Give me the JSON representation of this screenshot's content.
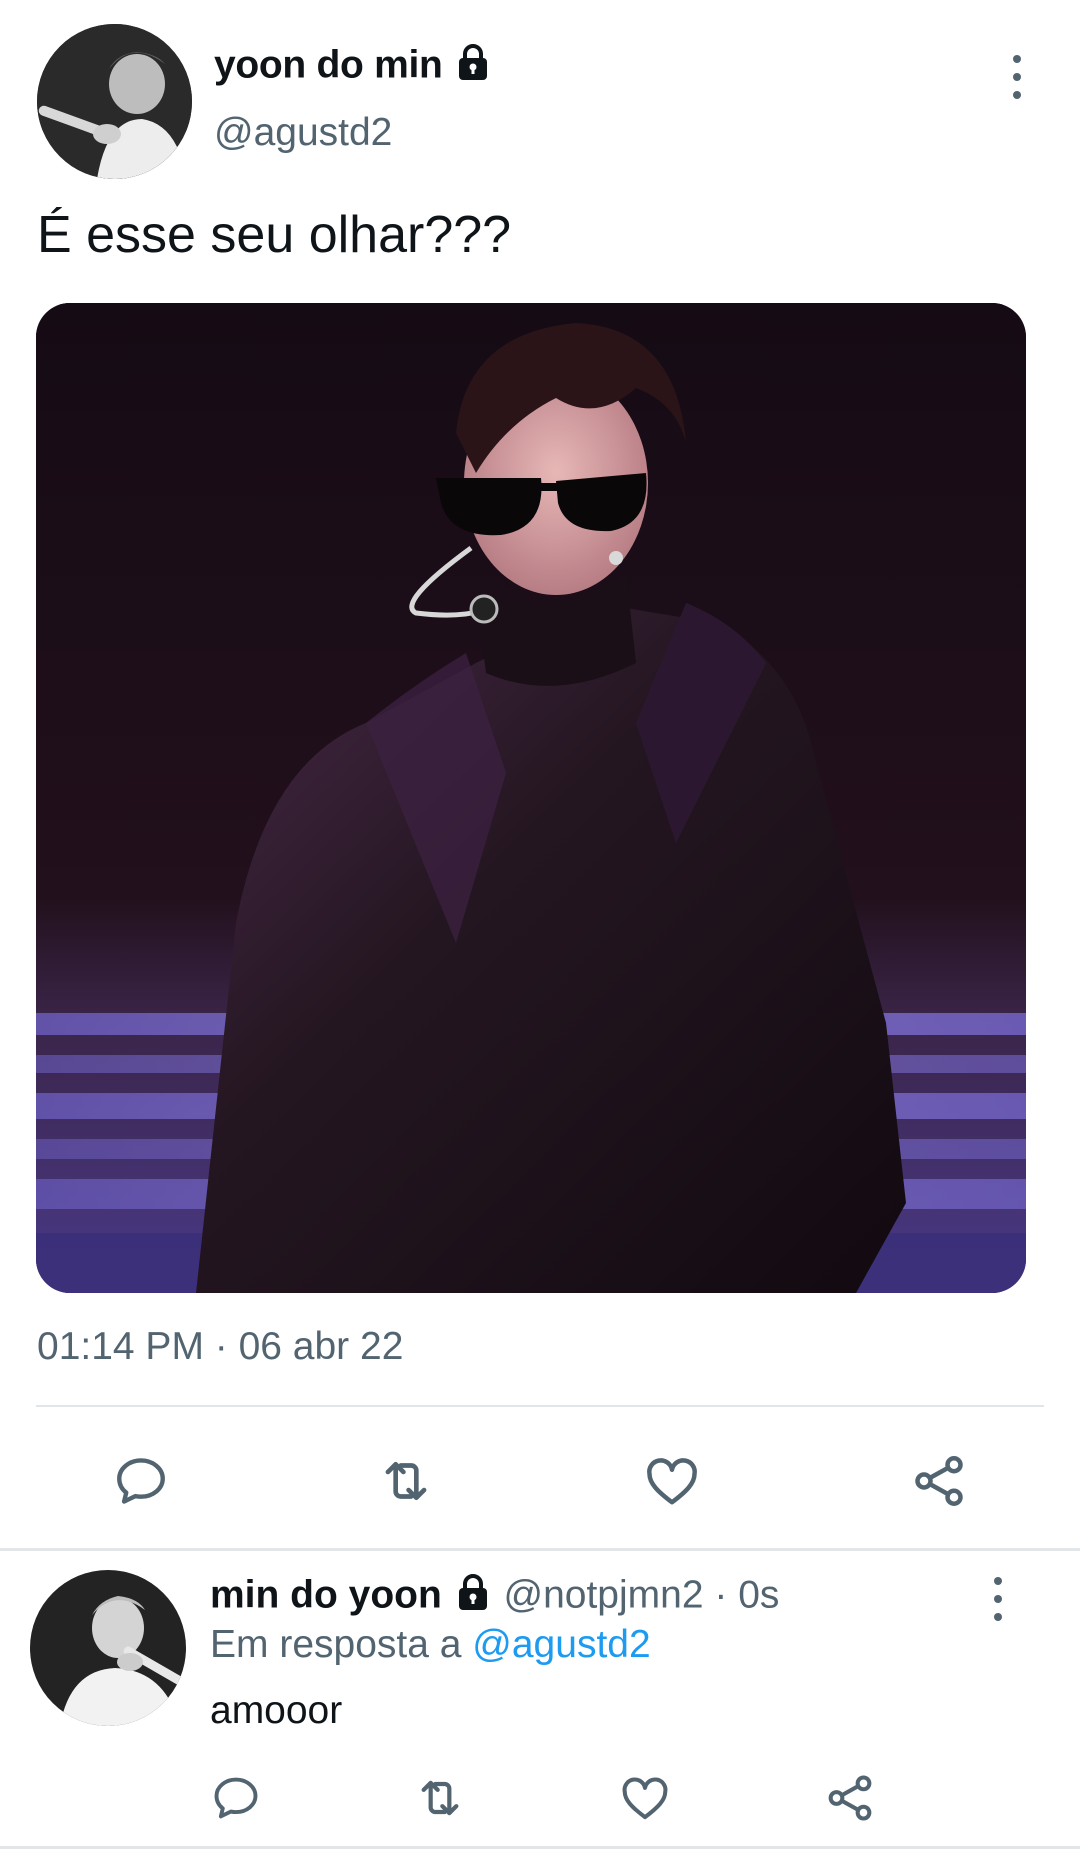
{
  "main_tweet": {
    "display_name": "yoon do min",
    "handle": "@agustd2",
    "text": "É esse seu olhar???",
    "timestamp": "01:14 PM · 06 abr 22",
    "protected_icon": "lock-icon",
    "media_icon": "photo-of-performer-in-black-suit"
  },
  "actions": {
    "reply_icon": "reply-icon",
    "retweet_icon": "retweet-icon",
    "like_icon": "heart-icon",
    "share_icon": "share-icon"
  },
  "reply": {
    "display_name": "min do yoon",
    "handle": "@notpjmn2",
    "separator": " · ",
    "time": "0s",
    "replying_to_prefix": "Em resposta a ",
    "replying_to": "@agustd2",
    "text": "amooor"
  },
  "colors": {
    "text": "#0f1419",
    "secondary": "#536471",
    "link": "#1d9bf0",
    "divider": "#e3e6e8"
  }
}
